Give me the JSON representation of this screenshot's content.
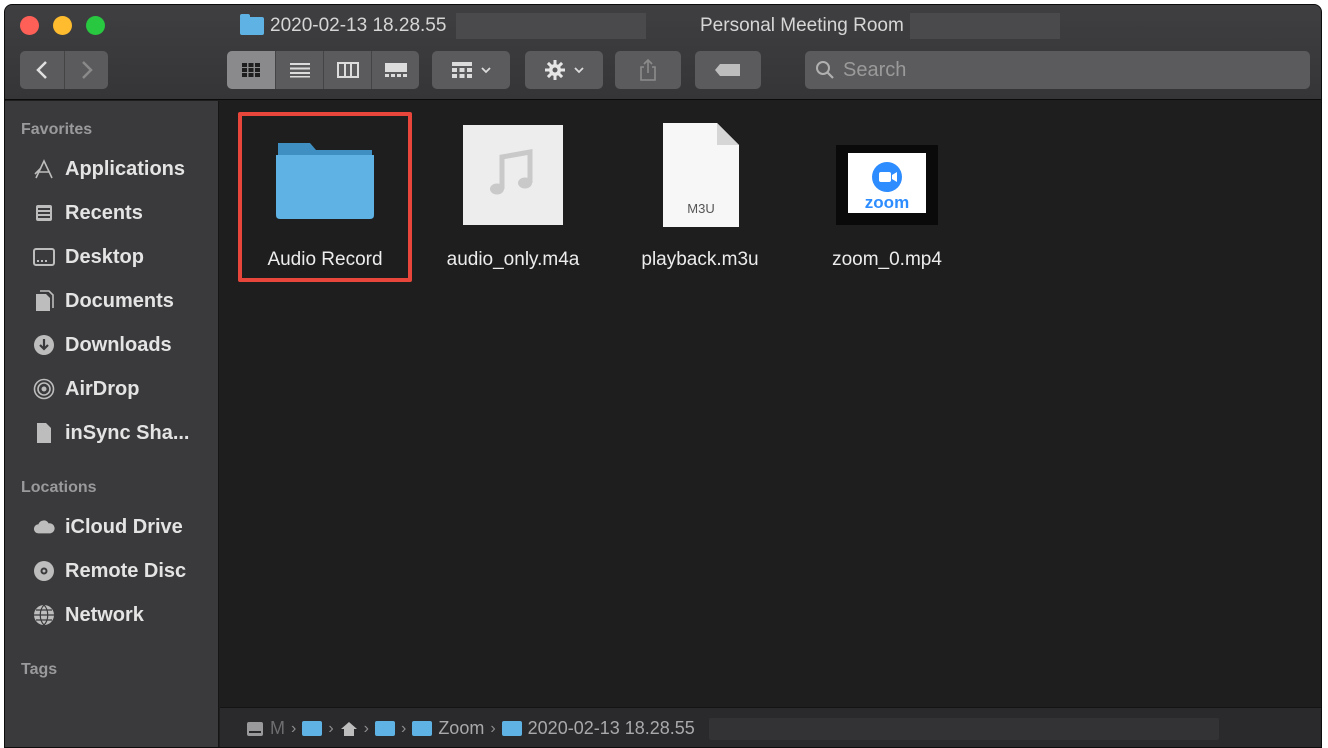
{
  "window": {
    "title": "2020-02-13 18.28.55",
    "title_suffix": "Personal Meeting Room"
  },
  "toolbar": {
    "back_icon": "chevron-left-icon",
    "forward_icon": "chevron-right-icon",
    "view_modes": [
      "icon-view",
      "list-view",
      "column-view",
      "gallery-view"
    ],
    "active_view": "icon-view",
    "search_placeholder": "Search"
  },
  "sidebar": {
    "favorites_heading": "Favorites",
    "favorites": [
      {
        "label": "Applications",
        "icon": "applications-icon"
      },
      {
        "label": "Recents",
        "icon": "recents-icon"
      },
      {
        "label": "Desktop",
        "icon": "desktop-icon"
      },
      {
        "label": "Documents",
        "icon": "documents-icon"
      },
      {
        "label": "Downloads",
        "icon": "downloads-icon"
      },
      {
        "label": "AirDrop",
        "icon": "airdrop-icon"
      },
      {
        "label": "inSync Sha...",
        "icon": "document-icon"
      }
    ],
    "locations_heading": "Locations",
    "locations": [
      {
        "label": "iCloud Drive",
        "icon": "cloud-icon"
      },
      {
        "label": "Remote Disc",
        "icon": "disc-icon"
      },
      {
        "label": "Network",
        "icon": "network-icon"
      }
    ],
    "tags_heading": "Tags"
  },
  "files": [
    {
      "name": "Audio Record",
      "kind": "folder",
      "selected": true
    },
    {
      "name": "audio_only.m4a",
      "kind": "audio"
    },
    {
      "name": "playback.m3u",
      "kind": "m3u",
      "badge": "M3U"
    },
    {
      "name": "zoom_0.mp4",
      "kind": "video",
      "badge": "zoom"
    }
  ],
  "pathbar": {
    "crumbs": [
      "M",
      "Zoom",
      "2020-02-13 18.28.55"
    ]
  },
  "colors": {
    "selection_outline": "#e8463b",
    "folder_blue": "#5eb3e4",
    "window_bg": "#1e1e1f",
    "sidebar_bg": "#3a3a3c"
  }
}
